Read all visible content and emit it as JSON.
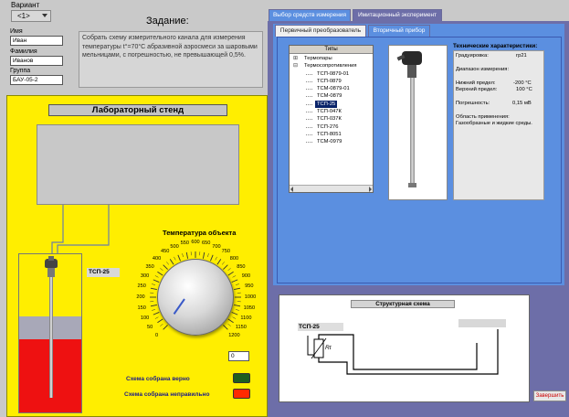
{
  "header": {
    "variant_label": "Вариант",
    "variant_value": "<1>",
    "name_label": "Имя",
    "name_value": "Иван",
    "surname_label": "Фамилия",
    "surname_value": "Иванов",
    "group_label": "Группа",
    "group_value": "БАУ-05-2"
  },
  "task": {
    "title": "Задание:",
    "text": "Собрать схему измерительного канала для измерения температуры t°=70°C абразивной аэросмеси за шаровыми мельницами, с погрешностью, не превышающей 0,5%."
  },
  "stand": {
    "title": "Лабораторный стенд",
    "sensor_label": "ТСП-25",
    "temp_title": "Температура объекта",
    "dial_ticks": [
      "0",
      "50",
      "100",
      "150",
      "200",
      "250",
      "300",
      "350",
      "400",
      "450",
      "500",
      "550",
      "600",
      "650",
      "700",
      "750",
      "800",
      "850",
      "900",
      "950",
      "1000",
      "1050",
      "1100",
      "1150",
      "1200"
    ],
    "temp_value": "0",
    "status_ok_label": "Схема собрана верно",
    "status_bad_label": "Схема собрана неправильно",
    "status_ok_color": "#1f5f1f",
    "status_bad_color": "#ff2a00"
  },
  "tabs": {
    "main": [
      "Выбор средств измерения",
      "Имитационный эксперимент"
    ],
    "sub": [
      "Первичный преобразователь",
      "Вторичный прибор"
    ]
  },
  "tree": {
    "header": "Типы",
    "items": [
      {
        "label": "Термопары",
        "level": 1,
        "expander": "+"
      },
      {
        "label": "Термосопротивления",
        "level": 1,
        "expander": "-"
      },
      {
        "label": "ТСП-0879-01",
        "level": 2
      },
      {
        "label": "ТСП-0879",
        "level": 2
      },
      {
        "label": "ТСМ-0879-01",
        "level": 2
      },
      {
        "label": "ТСМ-0879",
        "level": 2
      },
      {
        "label": "ТСП-25",
        "level": 2,
        "selected": true
      },
      {
        "label": "ТСП-047К",
        "level": 2
      },
      {
        "label": "ТСП-037К",
        "level": 2
      },
      {
        "label": "ТСП-276",
        "level": 2
      },
      {
        "label": "ТСП-8051",
        "level": 2
      },
      {
        "label": "ТСМ-0979",
        "level": 2
      }
    ]
  },
  "specs": {
    "title": "Технические характеристики:",
    "grad_label": "Градуировка:",
    "grad_value": "гр21",
    "range_label": "Диапазон измерения:",
    "low_label": "Нижний предел:",
    "low_value": "-200 °С",
    "high_label": "Верхний предел:",
    "high_value": "100 °С",
    "error_label": "Погрешность:",
    "error_value": "0,15 мВ",
    "area_label": "Область применения:",
    "area_value": "Газообразные и жидкие среды."
  },
  "schema": {
    "title": "Структурная схема",
    "sensor_label": "ТСП-25",
    "rt_label": "Rt"
  },
  "finish_button": "Завершить",
  "colors": {
    "stand_yellow": "#ffee00",
    "panel_blue": "#5b8fe0",
    "outer_purple": "#6d6ea8",
    "selection": "#0a246a"
  }
}
